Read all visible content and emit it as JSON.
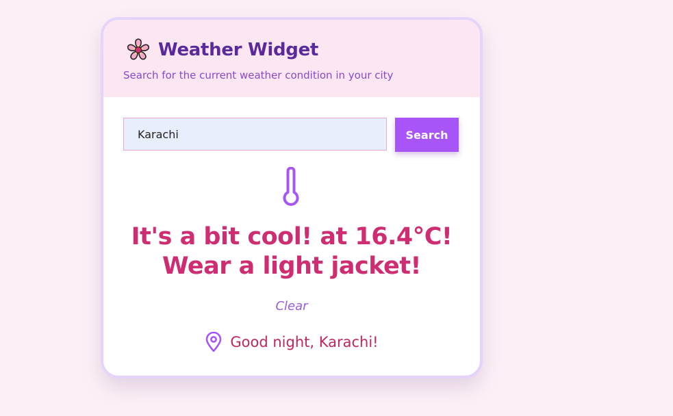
{
  "widget": {
    "title": "Weather Widget",
    "subtitle": "Search for the current weather condition in your city",
    "title_icon": "cherry-blossom-icon"
  },
  "search": {
    "value": "Karachi",
    "button_label": "Search"
  },
  "result": {
    "icon": "thermometer-icon",
    "message_line1": "It's a bit cool! at 16.4°C!",
    "message_line2": "Wear a light jacket!",
    "clear_label": "Clear",
    "location_icon": "map-pin-icon",
    "greeting": "Good night, Karachi!"
  },
  "colors": {
    "page_background": "#fcf0f6",
    "header_background": "#fce6f2",
    "title": "#5a2a9c",
    "accent_button": "#a855f7",
    "message": "#cf2d72",
    "input_background": "#e9eefc"
  }
}
